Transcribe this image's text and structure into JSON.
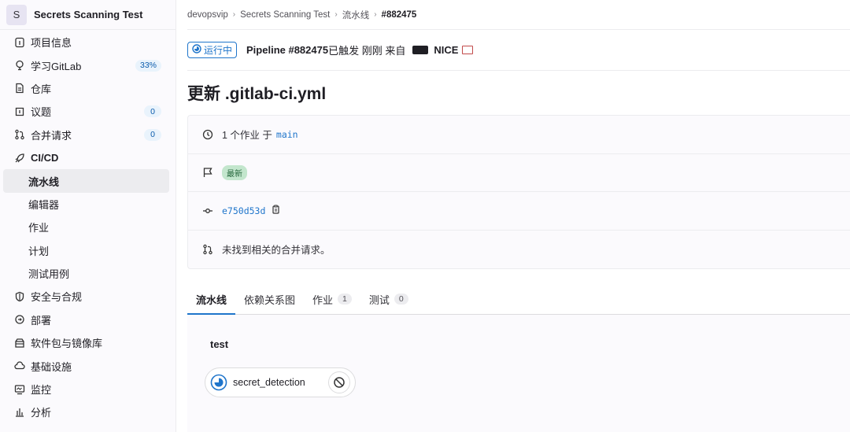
{
  "project": {
    "avatar_letter": "S",
    "name": "Secrets Scanning Test"
  },
  "sidebar": {
    "items": [
      {
        "label": "项目信息",
        "icon": "info-icon"
      },
      {
        "label": "学习GitLab",
        "icon": "bulb-icon",
        "badge": "33%"
      },
      {
        "label": "仓库",
        "icon": "doc-icon"
      },
      {
        "label": "议题",
        "icon": "issues-icon",
        "badge": "0"
      },
      {
        "label": "合并请求",
        "icon": "merge-request-icon",
        "badge": "0"
      },
      {
        "label": "CI/CD",
        "icon": "rocket-icon"
      },
      {
        "label": "流水线"
      },
      {
        "label": "编辑器"
      },
      {
        "label": "作业"
      },
      {
        "label": "计划"
      },
      {
        "label": "测试用例"
      },
      {
        "label": "安全与合规",
        "icon": "shield-icon"
      },
      {
        "label": "部署",
        "icon": "deploy-icon"
      },
      {
        "label": "软件包与镜像库",
        "icon": "package-icon"
      },
      {
        "label": "基础设施",
        "icon": "cloud-icon"
      },
      {
        "label": "监控",
        "icon": "monitor-icon"
      },
      {
        "label": "分析",
        "icon": "chart-icon"
      }
    ]
  },
  "breadcrumb": {
    "a": "devopsvip",
    "b": "Secrets Scanning Test",
    "c": "流水线",
    "current": "#882475"
  },
  "pipeline": {
    "status": "运行中",
    "text": "Pipeline #882475",
    "text_rest": " 已触发 刚刚 来自",
    "user": "NICE",
    "commit_title": "更新 .gitlab-ci.yml"
  },
  "info": {
    "jobs_text": "1 个作业 于",
    "branch": "main",
    "latest_badge": "最新",
    "commit_sha": "e750d53d",
    "mr_text": "未找到相关的合并请求。"
  },
  "tabs": [
    {
      "label": "流水线"
    },
    {
      "label": "依赖关系图"
    },
    {
      "label": "作业",
      "count": "1"
    },
    {
      "label": "测试",
      "count": "0"
    }
  ],
  "graph": {
    "stage": "test",
    "job": "secret_detection"
  },
  "colors": {
    "accent": "#1f75cb",
    "success_bg": "#c3e6cd",
    "success_fg": "#24663b"
  }
}
